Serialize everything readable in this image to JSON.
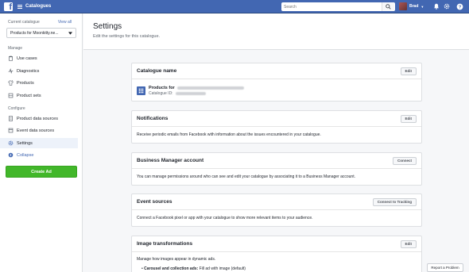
{
  "topbar": {
    "app_title": "Catalogues",
    "search_placeholder": "Search",
    "user_name": "Brad"
  },
  "sidebar": {
    "current_catalogue_label": "Current catalogue",
    "view_all": "View all",
    "catalogue_selected": "Products for Moonkitty.ne...",
    "manage_label": "Manage",
    "manage_items": [
      {
        "label": "Use cases",
        "icon": "use-cases-icon"
      },
      {
        "label": "Diagnostics",
        "icon": "diagnostics-icon"
      },
      {
        "label": "Products",
        "icon": "products-icon"
      },
      {
        "label": "Product sets",
        "icon": "product-sets-icon"
      }
    ],
    "configure_label": "Configure",
    "configure_items": [
      {
        "label": "Product data sources",
        "icon": "product-data-sources-icon"
      },
      {
        "label": "Event data sources",
        "icon": "event-data-sources-icon"
      },
      {
        "label": "Settings",
        "icon": "gear-icon"
      },
      {
        "label": "Collapse",
        "icon": "collapse-icon"
      }
    ],
    "create_ad": "Create Ad"
  },
  "page": {
    "title": "Settings",
    "subtitle": "Edit the settings for this catalogue."
  },
  "cards": {
    "catalogue_name": {
      "title": "Catalogue name",
      "button": "Edit",
      "products_for": "Products for",
      "catalogue_id_label": "Catalogue ID:"
    },
    "notifications": {
      "title": "Notifications",
      "button": "Edit",
      "body": "Receive periodic emails from Facebook with information about the issues encountered in your catalogue."
    },
    "business_manager": {
      "title": "Business Manager account",
      "button": "Connect",
      "body": "You can manage permissions around who can see and edit your catalogue by associating it to a Business Manager account."
    },
    "event_sources": {
      "title": "Event sources",
      "button": "Connect to Tracking",
      "body": "Connect a Facebook pixel or app with your catalogue to show more relevant items to your audience."
    },
    "image_transformations": {
      "title": "Image transformations",
      "button": "Edit",
      "body": "Manage how images appear in dynamic ads.",
      "bullet_bold": "Carousel and collection ads:",
      "bullet_rest": "Fill ad with image (default)"
    }
  },
  "report_problem": "Report a Problem",
  "colors": {
    "topbar": "#4267b2",
    "create_ad": "#42b72a",
    "active_nav_bg": "#edf2fa",
    "page_bg": "#f6f7f9"
  }
}
